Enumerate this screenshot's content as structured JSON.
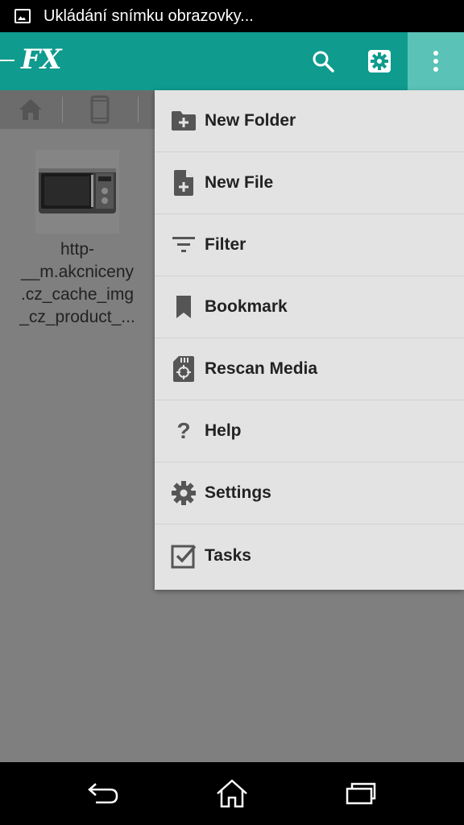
{
  "status_bar": {
    "notification_text": "Ukládání snímku obrazovky..."
  },
  "app_bar": {
    "logo_text": "FX",
    "actions": [
      "search-icon",
      "gear-icon",
      "more-vert-icon"
    ]
  },
  "tabs": {
    "items": [
      "home-icon",
      "phone-icon"
    ]
  },
  "file": {
    "name_lines": [
      "http-",
      "__m.akcniceny",
      ".cz_cache_img",
      "_cz_product_..."
    ]
  },
  "menu": {
    "items": [
      {
        "label": "New Folder",
        "icon": "folder-plus-icon"
      },
      {
        "label": "New File",
        "icon": "file-plus-icon"
      },
      {
        "label": "Filter",
        "icon": "filter-icon"
      },
      {
        "label": "Bookmark",
        "icon": "bookmark-icon"
      },
      {
        "label": "Rescan Media",
        "icon": "sd-card-icon"
      },
      {
        "label": "Help",
        "icon": "help-icon"
      },
      {
        "label": "Settings",
        "icon": "gear-icon"
      },
      {
        "label": "Tasks",
        "icon": "checkbox-icon"
      }
    ]
  },
  "colors": {
    "accent": "#0f9b8e",
    "accent_active": "#5bc2b8",
    "menu_bg": "#e3e3e3",
    "overlay": "#7f7f7f"
  }
}
